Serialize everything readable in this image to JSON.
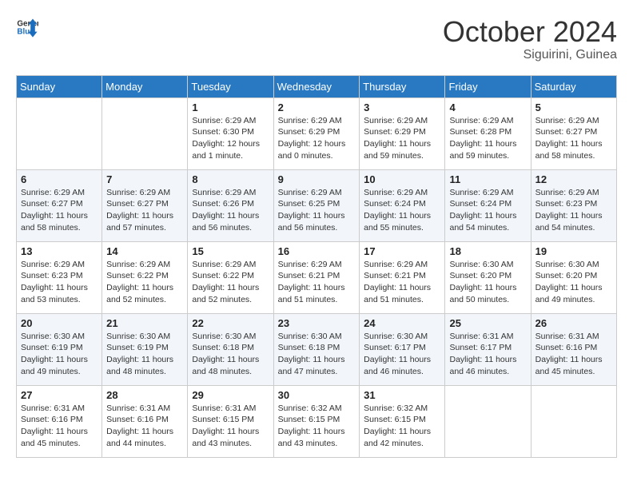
{
  "header": {
    "logo_line1": "General",
    "logo_line2": "Blue",
    "month": "October 2024",
    "location": "Siguirini, Guinea"
  },
  "weekdays": [
    "Sunday",
    "Monday",
    "Tuesday",
    "Wednesday",
    "Thursday",
    "Friday",
    "Saturday"
  ],
  "weeks": [
    [
      {
        "day": "",
        "detail": ""
      },
      {
        "day": "",
        "detail": ""
      },
      {
        "day": "1",
        "detail": "Sunrise: 6:29 AM\nSunset: 6:30 PM\nDaylight: 12 hours and 1 minute."
      },
      {
        "day": "2",
        "detail": "Sunrise: 6:29 AM\nSunset: 6:29 PM\nDaylight: 12 hours and 0 minutes."
      },
      {
        "day": "3",
        "detail": "Sunrise: 6:29 AM\nSunset: 6:29 PM\nDaylight: 11 hours and 59 minutes."
      },
      {
        "day": "4",
        "detail": "Sunrise: 6:29 AM\nSunset: 6:28 PM\nDaylight: 11 hours and 59 minutes."
      },
      {
        "day": "5",
        "detail": "Sunrise: 6:29 AM\nSunset: 6:27 PM\nDaylight: 11 hours and 58 minutes."
      }
    ],
    [
      {
        "day": "6",
        "detail": "Sunrise: 6:29 AM\nSunset: 6:27 PM\nDaylight: 11 hours and 58 minutes."
      },
      {
        "day": "7",
        "detail": "Sunrise: 6:29 AM\nSunset: 6:27 PM\nDaylight: 11 hours and 57 minutes."
      },
      {
        "day": "8",
        "detail": "Sunrise: 6:29 AM\nSunset: 6:26 PM\nDaylight: 11 hours and 56 minutes."
      },
      {
        "day": "9",
        "detail": "Sunrise: 6:29 AM\nSunset: 6:25 PM\nDaylight: 11 hours and 56 minutes."
      },
      {
        "day": "10",
        "detail": "Sunrise: 6:29 AM\nSunset: 6:24 PM\nDaylight: 11 hours and 55 minutes."
      },
      {
        "day": "11",
        "detail": "Sunrise: 6:29 AM\nSunset: 6:24 PM\nDaylight: 11 hours and 54 minutes."
      },
      {
        "day": "12",
        "detail": "Sunrise: 6:29 AM\nSunset: 6:23 PM\nDaylight: 11 hours and 54 minutes."
      }
    ],
    [
      {
        "day": "13",
        "detail": "Sunrise: 6:29 AM\nSunset: 6:23 PM\nDaylight: 11 hours and 53 minutes."
      },
      {
        "day": "14",
        "detail": "Sunrise: 6:29 AM\nSunset: 6:22 PM\nDaylight: 11 hours and 52 minutes."
      },
      {
        "day": "15",
        "detail": "Sunrise: 6:29 AM\nSunset: 6:22 PM\nDaylight: 11 hours and 52 minutes."
      },
      {
        "day": "16",
        "detail": "Sunrise: 6:29 AM\nSunset: 6:21 PM\nDaylight: 11 hours and 51 minutes."
      },
      {
        "day": "17",
        "detail": "Sunrise: 6:29 AM\nSunset: 6:21 PM\nDaylight: 11 hours and 51 minutes."
      },
      {
        "day": "18",
        "detail": "Sunrise: 6:30 AM\nSunset: 6:20 PM\nDaylight: 11 hours and 50 minutes."
      },
      {
        "day": "19",
        "detail": "Sunrise: 6:30 AM\nSunset: 6:20 PM\nDaylight: 11 hours and 49 minutes."
      }
    ],
    [
      {
        "day": "20",
        "detail": "Sunrise: 6:30 AM\nSunset: 6:19 PM\nDaylight: 11 hours and 49 minutes."
      },
      {
        "day": "21",
        "detail": "Sunrise: 6:30 AM\nSunset: 6:19 PM\nDaylight: 11 hours and 48 minutes."
      },
      {
        "day": "22",
        "detail": "Sunrise: 6:30 AM\nSunset: 6:18 PM\nDaylight: 11 hours and 48 minutes."
      },
      {
        "day": "23",
        "detail": "Sunrise: 6:30 AM\nSunset: 6:18 PM\nDaylight: 11 hours and 47 minutes."
      },
      {
        "day": "24",
        "detail": "Sunrise: 6:30 AM\nSunset: 6:17 PM\nDaylight: 11 hours and 46 minutes."
      },
      {
        "day": "25",
        "detail": "Sunrise: 6:31 AM\nSunset: 6:17 PM\nDaylight: 11 hours and 46 minutes."
      },
      {
        "day": "26",
        "detail": "Sunrise: 6:31 AM\nSunset: 6:16 PM\nDaylight: 11 hours and 45 minutes."
      }
    ],
    [
      {
        "day": "27",
        "detail": "Sunrise: 6:31 AM\nSunset: 6:16 PM\nDaylight: 11 hours and 45 minutes."
      },
      {
        "day": "28",
        "detail": "Sunrise: 6:31 AM\nSunset: 6:16 PM\nDaylight: 11 hours and 44 minutes."
      },
      {
        "day": "29",
        "detail": "Sunrise: 6:31 AM\nSunset: 6:15 PM\nDaylight: 11 hours and 43 minutes."
      },
      {
        "day": "30",
        "detail": "Sunrise: 6:32 AM\nSunset: 6:15 PM\nDaylight: 11 hours and 43 minutes."
      },
      {
        "day": "31",
        "detail": "Sunrise: 6:32 AM\nSunset: 6:15 PM\nDaylight: 11 hours and 42 minutes."
      },
      {
        "day": "",
        "detail": ""
      },
      {
        "day": "",
        "detail": ""
      }
    ]
  ]
}
